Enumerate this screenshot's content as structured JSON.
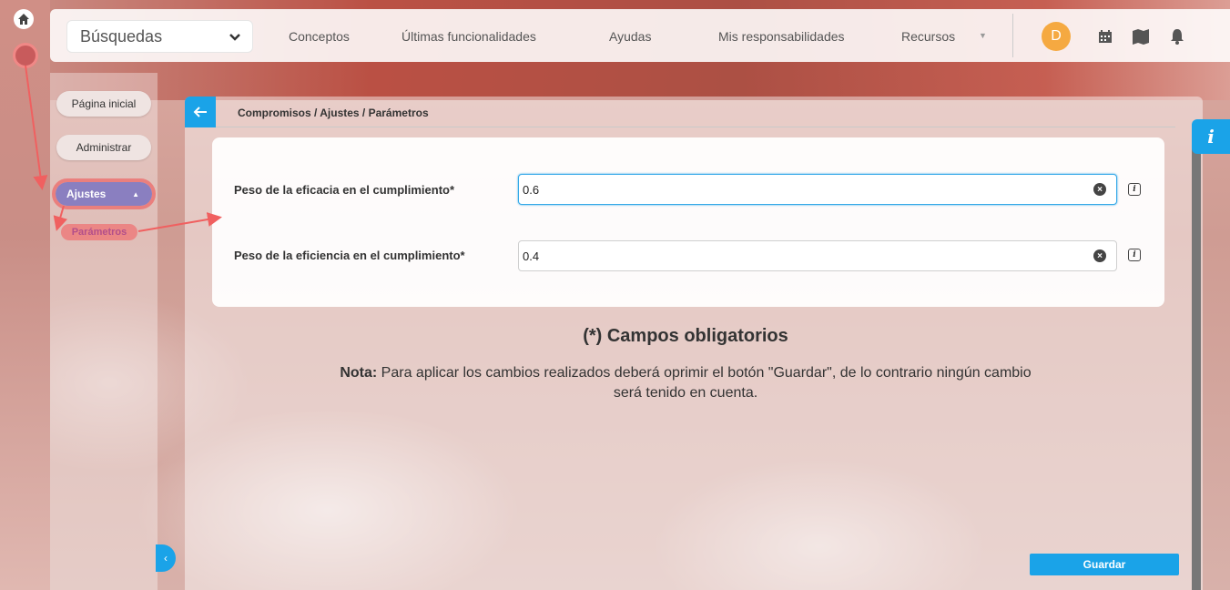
{
  "topbar": {
    "search_label": "Búsquedas",
    "nav": [
      "Conceptos",
      "Últimas funcionalidades",
      "Ayudas",
      "Mis responsabilidades",
      "Recursos"
    ],
    "avatar_initial": "D"
  },
  "sidebar": {
    "home": "Página inicial",
    "admin": "Administrar",
    "ajustes": "Ajustes",
    "parametros": "Parámetros"
  },
  "breadcrumb": "Compromisos / Ajustes / Parámetros",
  "form": {
    "eficacia_label": "Peso de la eficacia en el cumplimiento*",
    "eficacia_value": "0.6",
    "eficiencia_label": "Peso de la eficiencia en el cumplimiento*",
    "eficiencia_value": "0.4"
  },
  "required_text": "(*) Campos obligatorios",
  "note": {
    "prefix": "Nota:",
    "text": " Para aplicar los cambios realizados deberá oprimir el botón \"Guardar\", de lo contrario ningún cambio será tenido en cuenta."
  },
  "save_label": "Guardar",
  "colors": {
    "accent": "#1aa3e8",
    "annotation": "#f06060",
    "avatar": "#f5a941"
  }
}
